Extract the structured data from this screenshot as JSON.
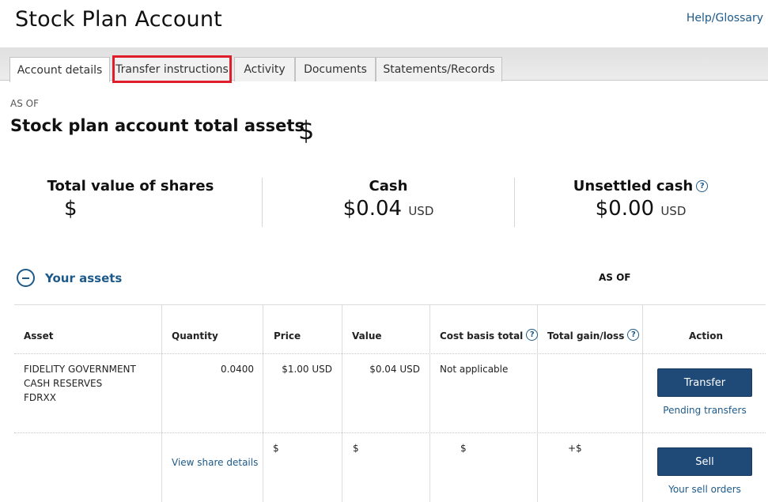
{
  "header": {
    "title": "Stock Plan Account",
    "help_label": "Help/Glossary"
  },
  "tabs": [
    {
      "label": "Account details"
    },
    {
      "label": "Transfer instructions"
    },
    {
      "label": "Activity"
    },
    {
      "label": "Documents"
    },
    {
      "label": "Statements/Records"
    }
  ],
  "account": {
    "as_of": "AS OF",
    "total_assets_label": "Stock plan account total assets",
    "total_assets_value": "$"
  },
  "summary": {
    "shares_label": "Total value of shares",
    "shares_value": "$",
    "cash_label": "Cash",
    "cash_value": "$0.04",
    "cash_unit": "USD",
    "unsettled_label": "Unsettled cash",
    "unsettled_value": "$0.00",
    "unsettled_unit": "USD"
  },
  "assets": {
    "title": "Your assets",
    "as_of": "AS OF",
    "headers": {
      "asset": "Asset",
      "quantity": "Quantity",
      "price": "Price",
      "value": "Value",
      "cost_basis": "Cost basis total",
      "gain_loss": "Total gain/loss",
      "action": "Action"
    },
    "rows": [
      {
        "asset_line1": "FIDELITY GOVERNMENT",
        "asset_line2": "CASH RESERVES",
        "asset_line3": "FDRXX",
        "quantity": "0.0400",
        "price": "$1.00 USD",
        "value": "$0.04 USD",
        "cost_basis": "Not applicable",
        "action_button": "Transfer",
        "action_link": "Pending transfers"
      },
      {
        "quantity_link": "View share details",
        "price": "$",
        "value": "$",
        "cost_basis": "$",
        "gain_loss": "+$",
        "action_button": "Sell",
        "action_link": "Your sell orders"
      }
    ]
  },
  "colors": {
    "primary_button": "#1f4a78",
    "link": "#1d5a8a",
    "highlight_box": "#e01d2a"
  }
}
